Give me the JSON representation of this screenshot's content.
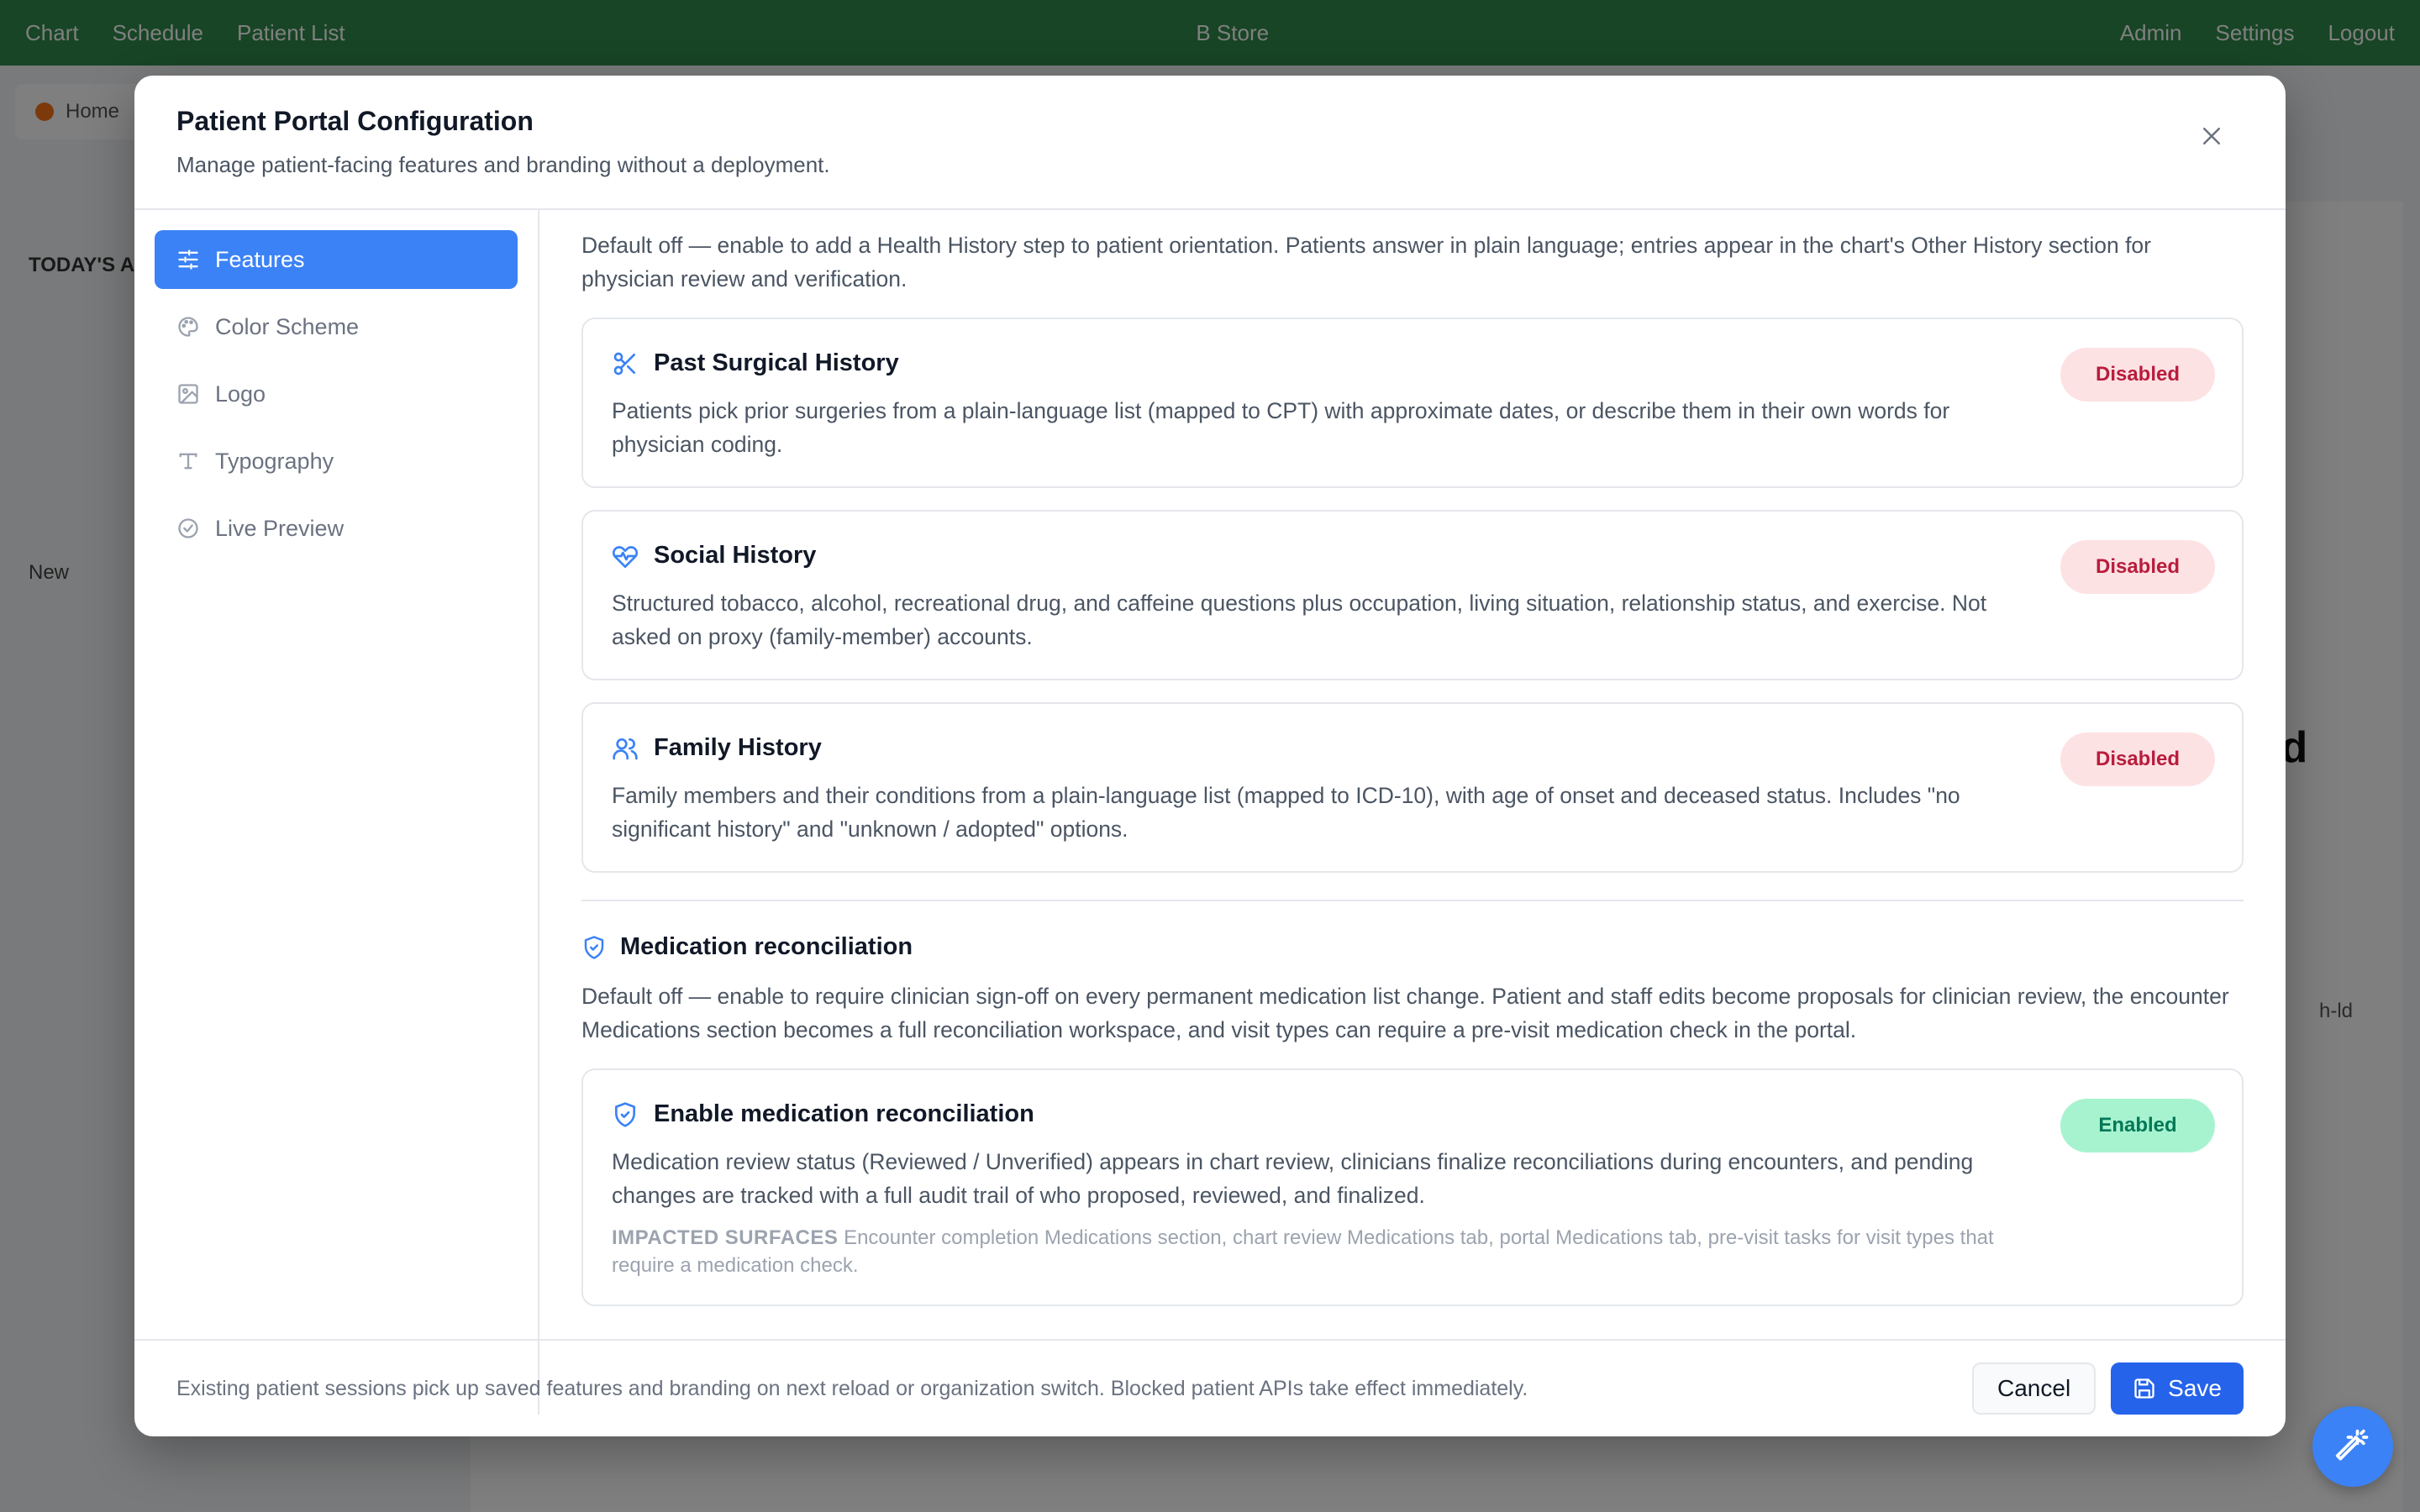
{
  "background": {
    "topbar": [
      "Chart",
      "Schedule",
      "Patient List"
    ],
    "center": "B Store",
    "right": [
      "Admin",
      "Settings",
      "Logout"
    ],
    "tab": "Home",
    "side_title": "TODAY'S A",
    "side_item": "New",
    "heading": "ld",
    "note": "h-ld"
  },
  "modal": {
    "title": "Patient Portal Configuration",
    "subtitle": "Manage patient-facing features and branding without a deployment."
  },
  "sidebar": {
    "items": [
      {
        "label": "Features",
        "icon": "sliders-icon"
      },
      {
        "label": "Color Scheme",
        "icon": "palette-icon"
      },
      {
        "label": "Logo",
        "icon": "image-icon"
      },
      {
        "label": "Typography",
        "icon": "type-icon"
      },
      {
        "label": "Live Preview",
        "icon": "check-circle-icon"
      }
    ]
  },
  "content": {
    "intro": "Default off — enable to add a Health History step to patient orientation. Patients answer in plain language; entries appear in the chart's Other History section for physician review and verification.",
    "cards": [
      {
        "title": "Past Surgical History",
        "desc": "Patients pick prior surgeries from a plain-language list (mapped to CPT) with approximate dates, or describe them in their own words for physician coding.",
        "status": "Disabled"
      },
      {
        "title": "Social History",
        "desc": "Structured tobacco, alcohol, recreational drug, and caffeine questions plus occupation, living situation, relationship status, and exercise. Not asked on proxy (family-member) accounts.",
        "status": "Disabled"
      },
      {
        "title": "Family History",
        "desc": "Family members and their conditions from a plain-language list (mapped to ICD-10), with age of onset and deceased status. Includes \"no significant history\" and \"unknown / adopted\" options.",
        "status": "Disabled"
      }
    ],
    "med_section": {
      "title": "Medication reconciliation",
      "desc": "Default off — enable to require clinician sign-off on every permanent medication list change. Patient and staff edits become proposals for clinician review, the encounter Medications section becomes a full reconciliation workspace, and visit types can require a pre-visit medication check in the portal.",
      "card": {
        "title": "Enable medication reconciliation",
        "desc": "Medication review status (Reviewed / Unverified) appears in chart review, clinicians finalize reconciliations during encounters, and pending changes are tracked with a full audit trail of who proposed, reviewed, and finalized.",
        "impacted_label": "IMPACTED SURFACES",
        "impacted_text": "Encounter completion Medications section, chart review Medications tab, portal Medications tab, pre-visit tasks for visit types that require a medication check.",
        "status": "Enabled"
      }
    }
  },
  "footer": {
    "note": "Existing patient sessions pick up saved features and branding on next reload or organization switch. Blocked patient APIs take effect immediately.",
    "cancel_label": "Cancel",
    "save_label": "Save"
  },
  "colors": {
    "accent": "#3b82f6",
    "disabled_bg": "#fde2e4",
    "disabled_text": "#b91c3c",
    "enabled_bg": "#a7f3d0",
    "enabled_text": "#047857"
  }
}
